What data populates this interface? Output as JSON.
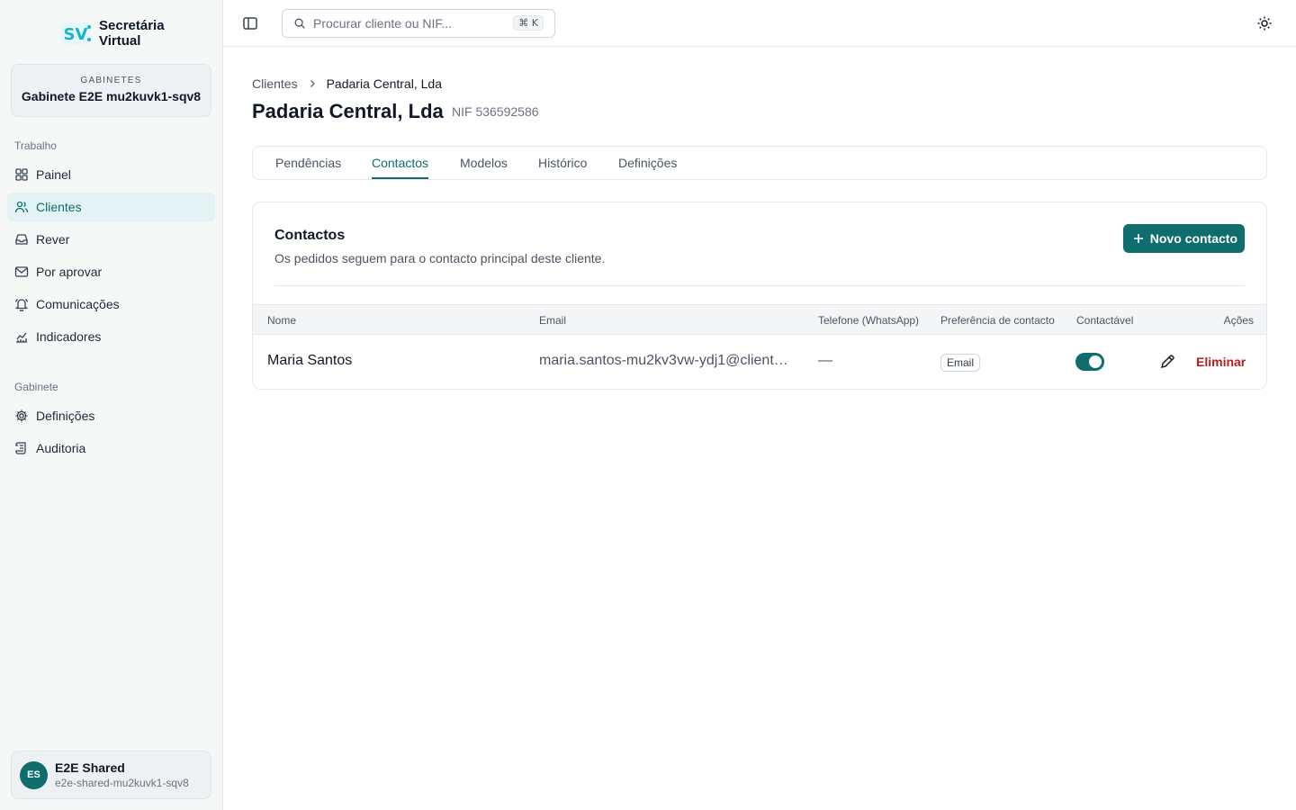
{
  "brand": {
    "name": "Secretária Virtual",
    "logo_icon": "sv-logo-icon",
    "accent": "#0f6d6d",
    "logo_color": "#18b5c9"
  },
  "org": {
    "label": "GABINETES",
    "name": "Gabinete E2E mu2kuvk1-sqv8"
  },
  "sidebar": {
    "sections": [
      {
        "label": "Trabalho",
        "items": [
          {
            "label": "Painel",
            "icon": "grid-icon"
          },
          {
            "label": "Clientes",
            "icon": "users-icon",
            "active": true
          },
          {
            "label": "Rever",
            "icon": "inbox-icon"
          },
          {
            "label": "Por aprovar",
            "icon": "mail-icon"
          },
          {
            "label": "Comunicações",
            "icon": "bell-icon"
          },
          {
            "label": "Indicadores",
            "icon": "chart-icon"
          }
        ]
      },
      {
        "label": "Gabinete",
        "items": [
          {
            "label": "Definições",
            "icon": "gear-icon"
          },
          {
            "label": "Auditoria",
            "icon": "scroll-icon"
          }
        ]
      }
    ]
  },
  "user": {
    "initials": "ES",
    "name": "E2E Shared",
    "email": "e2e-shared-mu2kuvk1-sqv8"
  },
  "topbar": {
    "search_placeholder": "Procurar cliente ou NIF...",
    "shortcut": "⌘ K"
  },
  "breadcrumb": {
    "parent": "Clientes",
    "current": "Padaria Central, Lda"
  },
  "client": {
    "name": "Padaria Central, Lda",
    "nif": "NIF 536592586"
  },
  "tabs": [
    {
      "label": "Pendências"
    },
    {
      "label": "Contactos",
      "active": true
    },
    {
      "label": "Modelos"
    },
    {
      "label": "Histórico"
    },
    {
      "label": "Definições"
    }
  ],
  "contacts": {
    "title": "Contactos",
    "description": "Os pedidos seguem para o contacto principal deste cliente.",
    "new_button": "Novo contacto",
    "columns": [
      "Nome",
      "Email",
      "Telefone (WhatsApp)",
      "Preferência de contacto",
      "Contactável",
      "Ações"
    ],
    "rows": [
      {
        "name": "Maria Santos",
        "email": "maria.santos-mu2kv3vw-ydj1@client…",
        "phone": "—",
        "preference": "Email",
        "contactable": true,
        "delete_label": "Eliminar"
      }
    ]
  }
}
